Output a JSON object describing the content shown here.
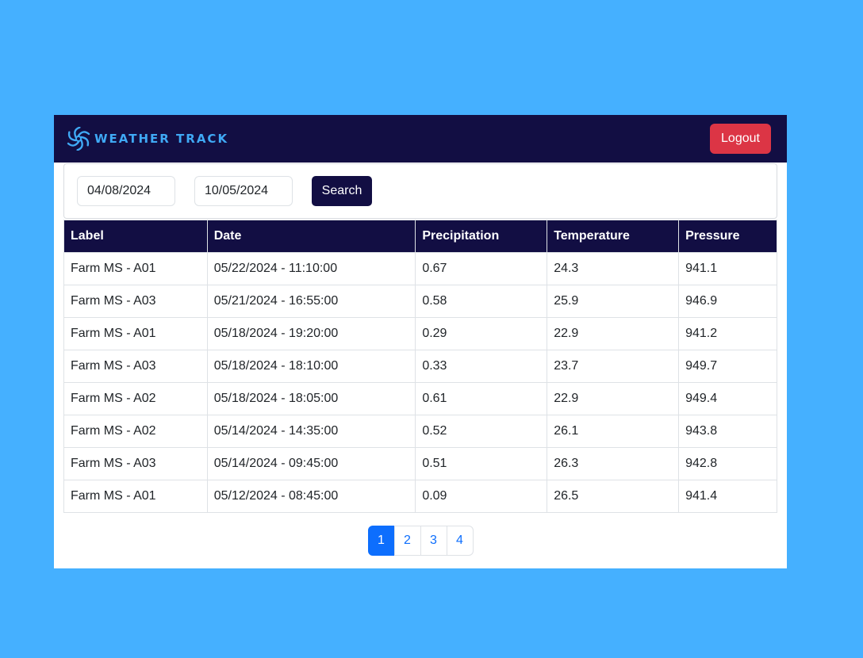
{
  "brand": {
    "name": "WEATHER TRACK",
    "icon": "swirl-logo-icon",
    "color": "#3fa9f5"
  },
  "navbar": {
    "logout_label": "Logout",
    "background": "#120e43"
  },
  "filters": {
    "start_date": "04/08/2024",
    "end_date": "10/05/2024",
    "search_label": "Search"
  },
  "table": {
    "headers": [
      "Label",
      "Date",
      "Precipitation",
      "Temperature",
      "Pressure"
    ],
    "rows": [
      [
        "Farm MS - A01",
        "05/22/2024 - 11:10:00",
        "0.67",
        "24.3",
        "941.1"
      ],
      [
        "Farm MS - A03",
        "05/21/2024 - 16:55:00",
        "0.58",
        "25.9",
        "946.9"
      ],
      [
        "Farm MS - A01",
        "05/18/2024 - 19:20:00",
        "0.29",
        "22.9",
        "941.2"
      ],
      [
        "Farm MS - A03",
        "05/18/2024 - 18:10:00",
        "0.33",
        "23.7",
        "949.7"
      ],
      [
        "Farm MS - A02",
        "05/18/2024 - 18:05:00",
        "0.61",
        "22.9",
        "949.4"
      ],
      [
        "Farm MS - A02",
        "05/14/2024 - 14:35:00",
        "0.52",
        "26.1",
        "943.8"
      ],
      [
        "Farm MS - A03",
        "05/14/2024 - 09:45:00",
        "0.51",
        "26.3",
        "942.8"
      ],
      [
        "Farm MS - A01",
        "05/12/2024 - 08:45:00",
        "0.09",
        "26.5",
        "941.4"
      ]
    ]
  },
  "pagination": {
    "pages": [
      "1",
      "2",
      "3",
      "4"
    ],
    "active": "1"
  },
  "colors": {
    "page_background": "#45b0ff",
    "logout": "#dc3545",
    "accent": "#0d6efd"
  }
}
